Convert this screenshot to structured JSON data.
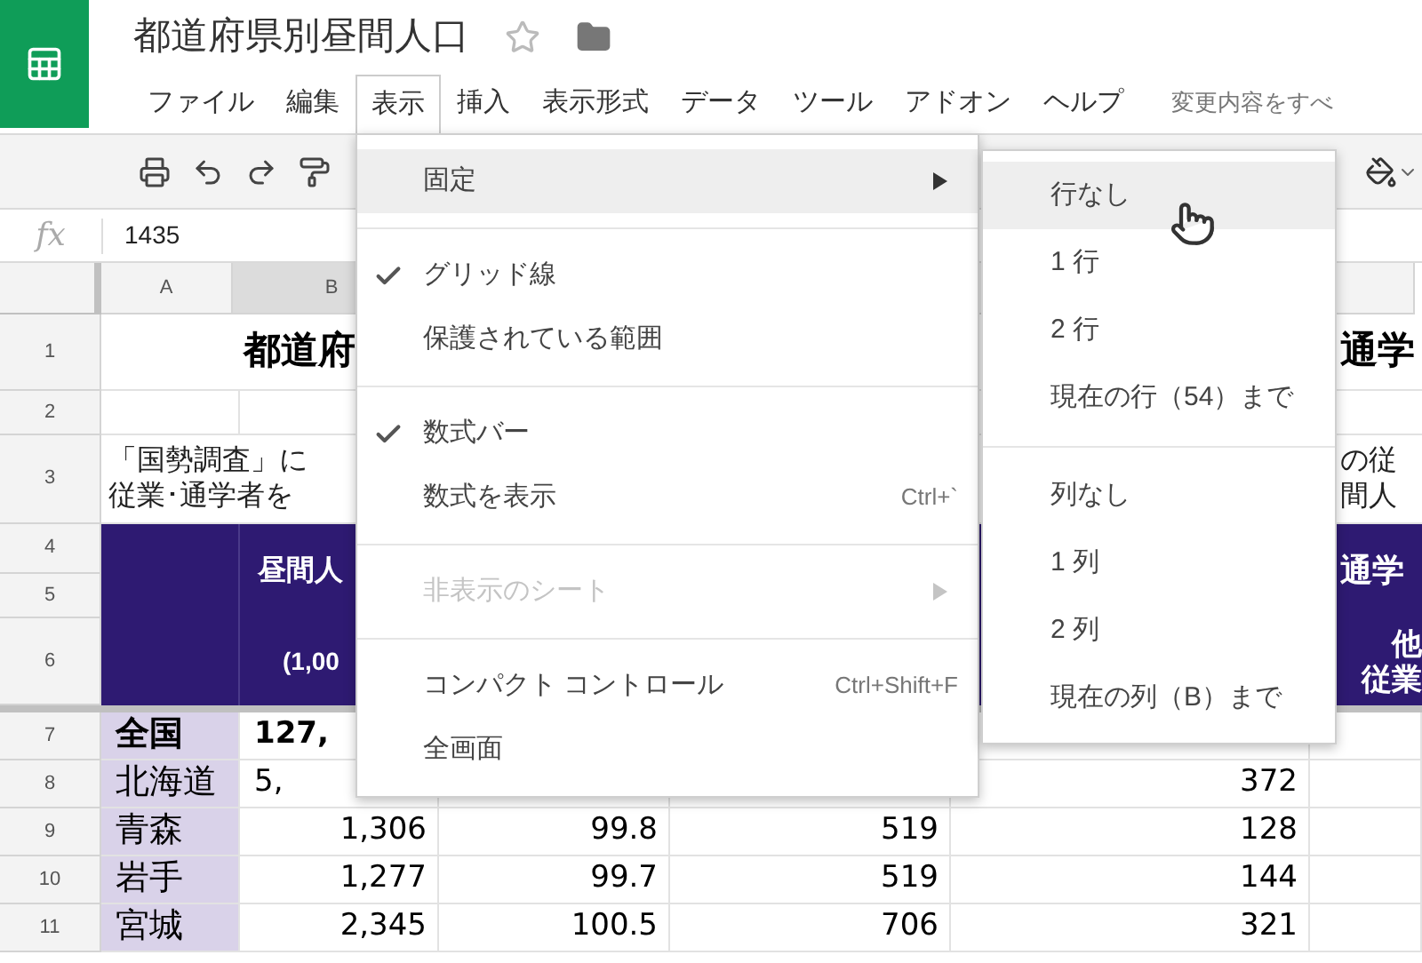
{
  "document": {
    "title": "都道府県別昼間人口",
    "starred": false
  },
  "menubar": [
    {
      "label": "ファイル",
      "selected": false
    },
    {
      "label": "編集",
      "selected": false
    },
    {
      "label": "表示",
      "selected": true
    },
    {
      "label": "挿入",
      "selected": false
    },
    {
      "label": "表示形式",
      "selected": false
    },
    {
      "label": "データ",
      "selected": false
    },
    {
      "label": "ツール",
      "selected": false
    },
    {
      "label": "アドオン",
      "selected": false
    },
    {
      "label": "ヘルプ",
      "selected": false
    }
  ],
  "save_status": "変更内容をすべ",
  "formula_bar": {
    "label": "fx",
    "value": "1435"
  },
  "columns": [
    "A",
    "B"
  ],
  "title_row": {
    "number": "1",
    "left": "都道府",
    "right": "通学"
  },
  "blank_row": {
    "number": "2"
  },
  "note_row": {
    "number": "3",
    "left_lines": [
      "「国勢調査」に",
      "従業･通学者を"
    ],
    "right_lines": [
      "の従",
      "間人"
    ]
  },
  "header_block": {
    "numbers": [
      "4",
      "5",
      "6"
    ],
    "top_left": "昼間人",
    "top_right": "通学",
    "bottom_left": "(1,00",
    "bottom_right_lines": [
      "他",
      "従業"
    ]
  },
  "data_rows": [
    {
      "number": "7",
      "bold": true,
      "partial": true,
      "A": "全国",
      "B": "127,"
    },
    {
      "number": "8",
      "bold": false,
      "partial": true,
      "A": "北海道",
      "B": "5,",
      "E": "372"
    },
    {
      "number": "9",
      "bold": false,
      "partial": false,
      "A": "青森",
      "B": "1,306",
      "C": "99.8",
      "D": "519",
      "E": "128"
    },
    {
      "number": "10",
      "bold": false,
      "partial": false,
      "A": "岩手",
      "B": "1,277",
      "C": "99.7",
      "D": "519",
      "E": "144"
    },
    {
      "number": "11",
      "bold": false,
      "partial": false,
      "A": "宮城",
      "B": "2,345",
      "C": "100.5",
      "D": "706",
      "E": "321"
    }
  ],
  "view_menu": [
    {
      "kind": "item",
      "label": "固定",
      "selected": true,
      "checked": false,
      "disabled": false,
      "submenu": true
    },
    {
      "kind": "separator"
    },
    {
      "kind": "item",
      "label": "グリッド線",
      "selected": false,
      "checked": true,
      "disabled": false,
      "submenu": false
    },
    {
      "kind": "item",
      "label": "保護されている範囲",
      "selected": false,
      "checked": false,
      "disabled": false,
      "submenu": false
    },
    {
      "kind": "separator"
    },
    {
      "kind": "item",
      "label": "数式バー",
      "selected": false,
      "checked": true,
      "disabled": false,
      "submenu": false
    },
    {
      "kind": "item",
      "label": "数式を表示",
      "shortcut": "Ctrl+`",
      "selected": false,
      "checked": false,
      "disabled": false,
      "submenu": false
    },
    {
      "kind": "separator"
    },
    {
      "kind": "item",
      "label": "非表示のシート",
      "selected": false,
      "checked": false,
      "disabled": true,
      "submenu": true
    },
    {
      "kind": "separator"
    },
    {
      "kind": "item",
      "label": "コンパクト コントロール",
      "shortcut": "Ctrl+Shift+F",
      "selected": false,
      "checked": false,
      "disabled": false,
      "submenu": false
    },
    {
      "kind": "item",
      "label": "全画面",
      "selected": false,
      "checked": false,
      "disabled": false,
      "submenu": false
    }
  ],
  "freeze_submenu": [
    {
      "kind": "item",
      "label": "行なし",
      "selected": true
    },
    {
      "kind": "item",
      "label": "1 行",
      "selected": false
    },
    {
      "kind": "item",
      "label": "2 行",
      "selected": false
    },
    {
      "kind": "item",
      "label": "現在の行（54）まで",
      "selected": false
    },
    {
      "kind": "separator"
    },
    {
      "kind": "item",
      "label": "列なし",
      "selected": false
    },
    {
      "kind": "item",
      "label": "1 列",
      "selected": false
    },
    {
      "kind": "item",
      "label": "2 列",
      "selected": false
    },
    {
      "kind": "item",
      "label": "現在の列（B）まで",
      "selected": false
    }
  ]
}
